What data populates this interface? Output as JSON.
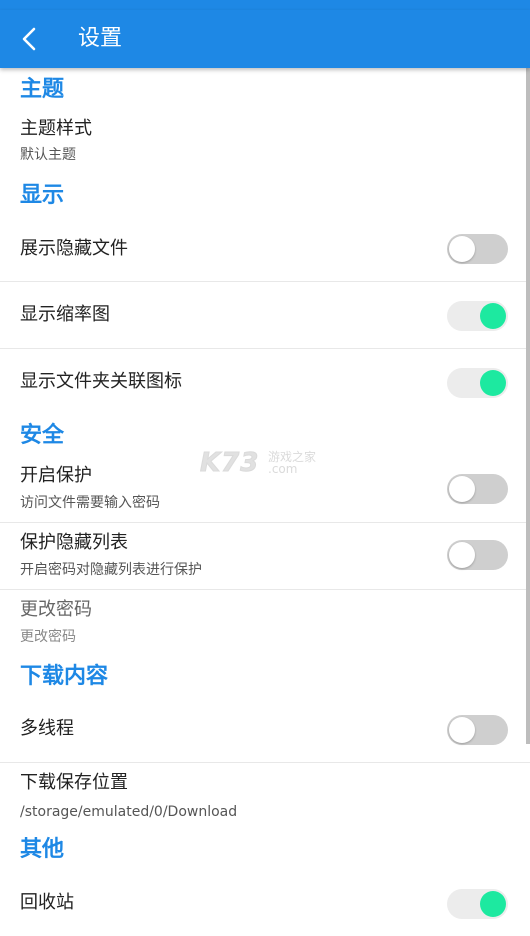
{
  "header": {
    "title": "设置"
  },
  "sections": {
    "theme": {
      "title": "主题",
      "style": {
        "label": "主题样式",
        "sub": "默认主题"
      }
    },
    "display": {
      "title": "显示",
      "show_hidden": {
        "label": "展示隐藏文件",
        "on": false
      },
      "thumbnails": {
        "label": "显示缩率图",
        "on": true
      },
      "folder_icons": {
        "label": "显示文件夹关联图标",
        "on": true
      }
    },
    "security": {
      "title": "安全",
      "protect": {
        "label": "开启保护",
        "sub": "访问文件需要输入密码",
        "on": false
      },
      "protect_hidden": {
        "label": "保护隐藏列表",
        "sub": "开启密码对隐藏列表进行保护",
        "on": false
      },
      "change_pwd": {
        "label": "更改密码",
        "sub": "更改密码"
      }
    },
    "download": {
      "title": "下载内容",
      "multithread": {
        "label": "多线程",
        "on": false
      },
      "location": {
        "label": "下载保存位置",
        "sub": "/storage/emulated/0/Download"
      }
    },
    "other": {
      "title": "其他",
      "recycle": {
        "label": "回收站",
        "on": true
      }
    }
  },
  "watermark": {
    "main": "K73",
    "top": "游戏之家",
    "bottom": ".com"
  },
  "colors": {
    "accent": "#1e88e5",
    "toggle_on": "#1de9a0",
    "toggle_off": "#cfcfcf"
  }
}
